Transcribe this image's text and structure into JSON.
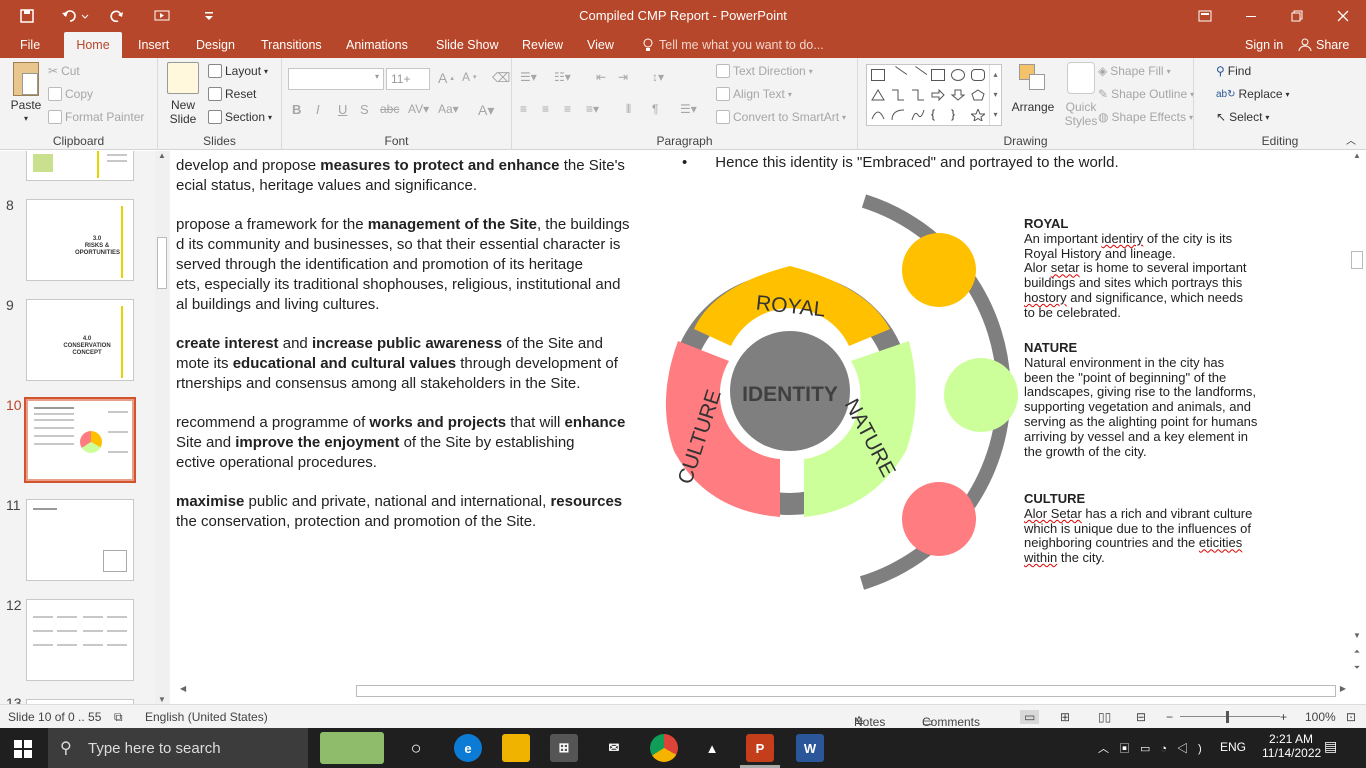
{
  "window": {
    "title": "Compiled CMP Report - PowerPoint"
  },
  "tabs": [
    "File",
    "Home",
    "Insert",
    "Design",
    "Transitions",
    "Animations",
    "Slide Show",
    "Review",
    "View"
  ],
  "tell_me": "Tell me what you want to do...",
  "signin": "Sign in",
  "share": "Share",
  "ribbon": {
    "clipboard": {
      "label": "Clipboard",
      "paste": "Paste",
      "cut": "Cut",
      "copy": "Copy",
      "format_painter": "Format Painter"
    },
    "slides": {
      "label": "Slides",
      "new_slide_1": "New",
      "new_slide_2": "Slide",
      "layout": "Layout",
      "reset": "Reset",
      "section": "Section"
    },
    "font": {
      "label": "Font",
      "size": "11+"
    },
    "paragraph": {
      "label": "Paragraph",
      "text_direction": "Text Direction",
      "align_text": "Align Text",
      "convert_smartart": "Convert to SmartArt"
    },
    "drawing": {
      "label": "Drawing",
      "arrange": "Arrange",
      "quick_styles_1": "Quick",
      "quick_styles_2": "Styles",
      "shape_fill": "Shape Fill",
      "shape_outline": "Shape Outline",
      "shape_effects": "Shape Effects"
    },
    "editing": {
      "label": "Editing",
      "find": "Find",
      "replace": "Replace",
      "select": "Select"
    }
  },
  "thumbnails": [
    {
      "num": "8",
      "lines": [
        "3.0",
        "RISKS &",
        "OPORTUNITIES"
      ]
    },
    {
      "num": "9",
      "lines": [
        "4.0",
        "CONSERVATION",
        "CONCEPT"
      ]
    },
    {
      "num": "10",
      "lines": []
    },
    {
      "num": "11",
      "lines": []
    },
    {
      "num": "12",
      "lines": []
    },
    {
      "num": "13",
      "lines": []
    }
  ],
  "slide": {
    "paragraphs": [
      {
        "parts": [
          [
            "develop and propose ",
            false
          ],
          [
            "measures to protect and enhance",
            true
          ],
          [
            " the Site's",
            false
          ]
        ],
        "line2": "ecial status, heritage values and significance."
      },
      {
        "parts": [
          [
            "propose a framework for the ",
            false
          ],
          [
            "management of the Site",
            true
          ],
          [
            ", the buildings",
            false
          ]
        ],
        "line2": "d its community and businesses, so that their essential character is",
        "line3": "served through the identification and promotion of its heritage",
        "line4": "ets, especially its traditional shophouses, religious, institutional and",
        "line5": "al buildings and living cultures."
      },
      {
        "parts": [
          [
            "create interest",
            true
          ],
          [
            " and ",
            false
          ],
          [
            "increase public awareness",
            true
          ],
          [
            " of the Site and",
            false
          ]
        ],
        "line2_parts": [
          [
            "mote its ",
            false
          ],
          [
            "educational and cultural values",
            true
          ],
          [
            " through development of",
            false
          ]
        ],
        "line3": "rtnerships and consensus among all stakeholders in the Site."
      },
      {
        "parts": [
          [
            "recommend a programme of ",
            false
          ],
          [
            "works and projects",
            true
          ],
          [
            " that will ",
            false
          ],
          [
            "enhance",
            true
          ]
        ],
        "line2_parts": [
          [
            " Site and ",
            false
          ],
          [
            "improve the enjoyment",
            true
          ],
          [
            " of the Site by establishing",
            false
          ]
        ],
        "line3": "ective operational procedures."
      },
      {
        "parts": [
          [
            "maximise",
            true
          ],
          [
            " public and private, national and international, ",
            false
          ],
          [
            "resources",
            true
          ]
        ],
        "line2": "the conservation, protection and promotion of the Site."
      }
    ],
    "bullet_mark": "•",
    "bullet": "Hence this identity is \"Embraced\" and portrayed to the world.",
    "diagram": {
      "center": "IDENTITY",
      "royal": "ROYAL",
      "nature": "NATURE",
      "culture": "CULTURE"
    },
    "royal": {
      "heading": "ROYAL",
      "l1a": "An important ",
      "l1s": "identiry",
      "l1b": " of the city is its",
      "l2": "Royal History and lineage.",
      "l3a": "Alor ",
      "l3s": "setar",
      "l3b": " is home to several important",
      "l4": "buildings and sites which portrays this",
      "l5s": "hostory",
      "l5b": " and significance, which needs",
      "l6": "to be celebrated."
    },
    "nature": {
      "heading": "NATURE",
      "lines": [
        "Natural environment in the city has",
        "been the \"point of beginning\" of the",
        "landscapes, giving rise to the landforms,",
        "supporting vegetation and animals, and",
        "serving as the alighting point for humans",
        "arriving by vessel and a key element in",
        "the growth of the city."
      ]
    },
    "culture": {
      "heading": "CULTURE",
      "l1s": "Alor Setar",
      "l1b": " has a rich and vibrant culture",
      "l2": "which is unique due to the influences of",
      "l3a": "neighboring countries and the ",
      "l3s": "eticities",
      "l4s": "within",
      "l4b": " the city."
    }
  },
  "status": {
    "slide": "Slide 10 of 0 .. 55",
    "language": "English (United States)",
    "notes": "Notes",
    "comments": "Comments",
    "zoom": "100%"
  },
  "taskbar": {
    "search": "Type here to search",
    "lang": "ENG",
    "time": "2:21 AM",
    "date": "11/14/2022"
  },
  "colors": {
    "accent": "#b7472a",
    "royal": "#ffc000",
    "nature": "#ccff99",
    "culture": "#ff7c80",
    "identity": "#7f7f7f"
  }
}
